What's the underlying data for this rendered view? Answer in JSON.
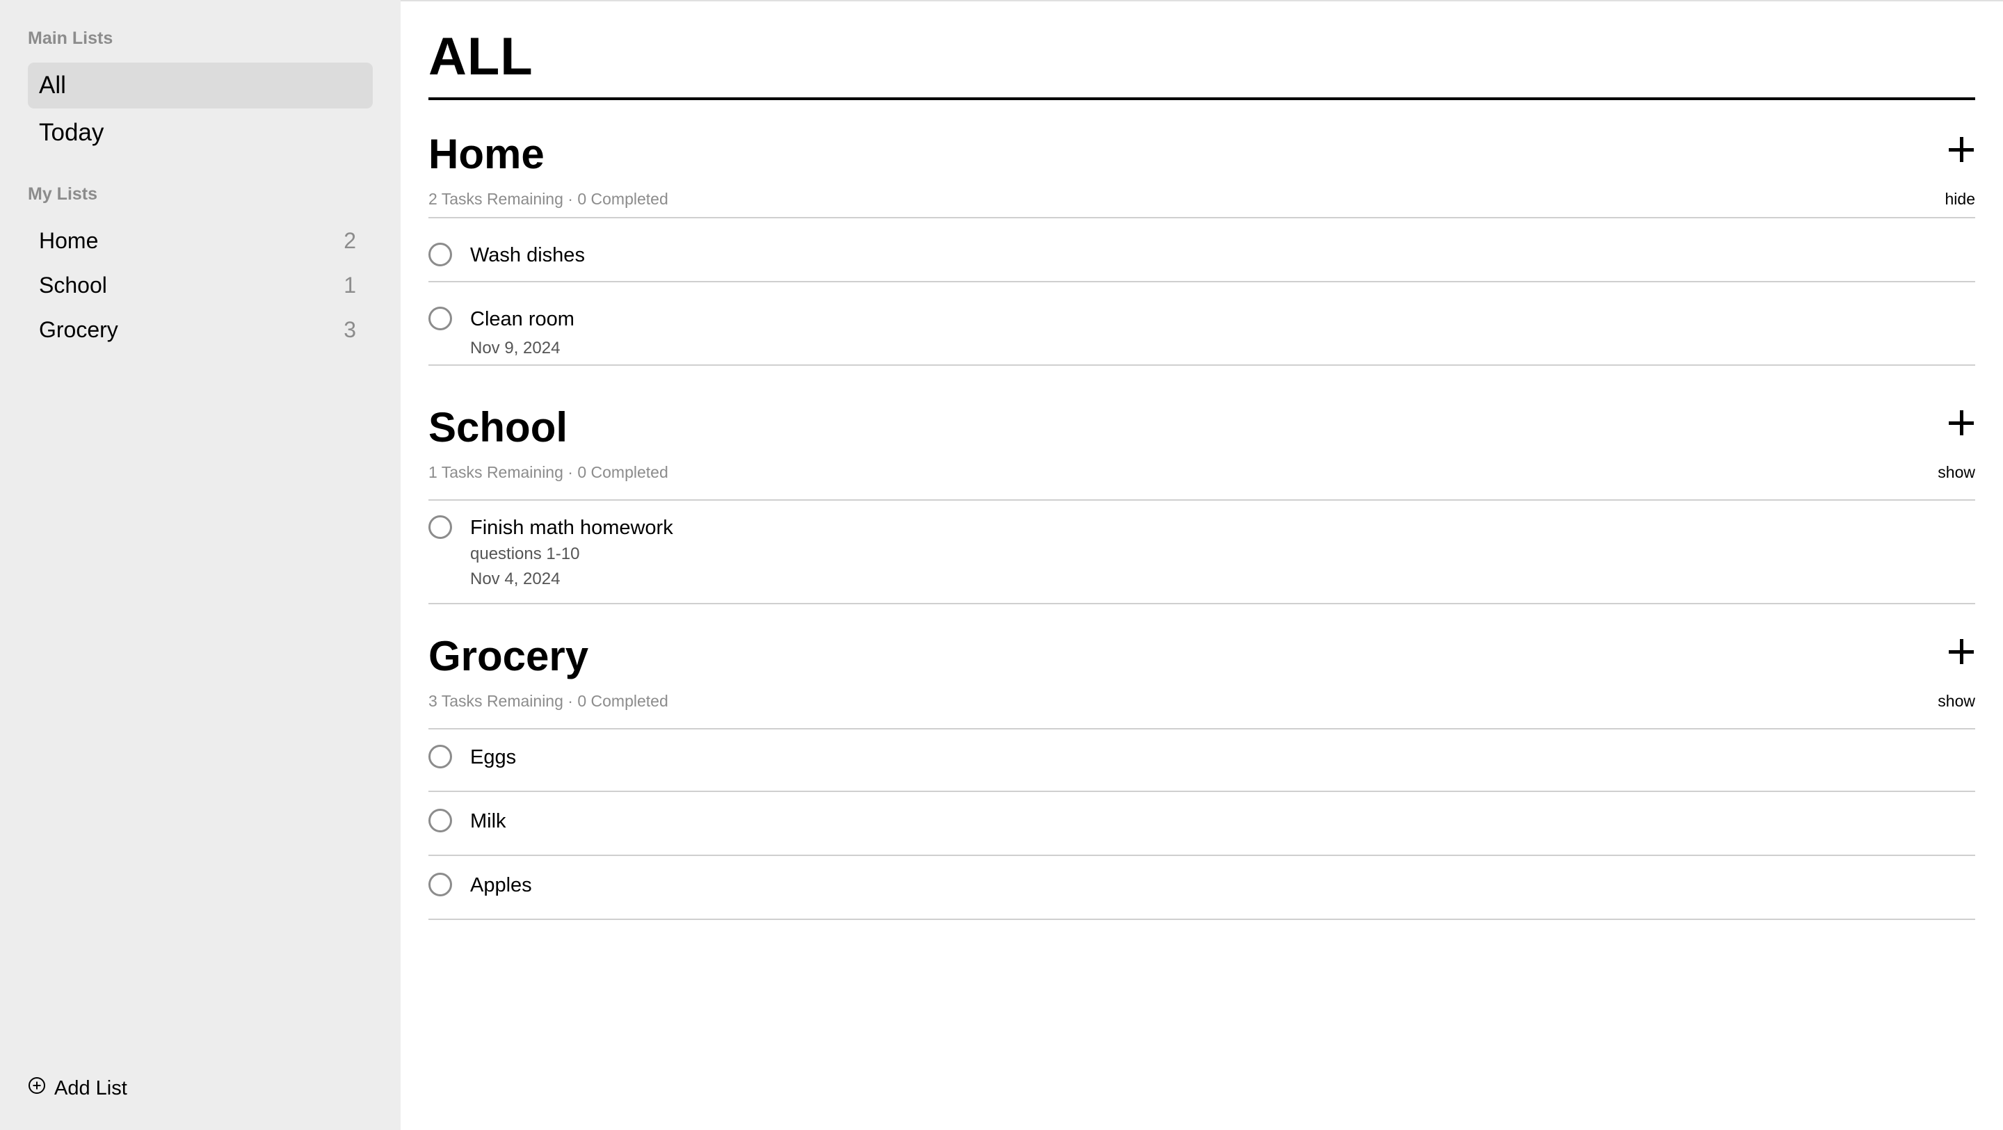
{
  "sidebar": {
    "main_heading": "Main Lists",
    "main_items": [
      {
        "label": "All"
      },
      {
        "label": "Today"
      }
    ],
    "my_heading": "My Lists",
    "my_items": [
      {
        "label": "Home",
        "count": "2"
      },
      {
        "label": "School",
        "count": "1"
      },
      {
        "label": "Grocery",
        "count": "3"
      }
    ],
    "add_list_label": "Add List"
  },
  "main": {
    "title": "ALL",
    "sections": [
      {
        "title": "Home",
        "meta": "2 Tasks Remaining · 0 Completed",
        "toggle": "hide",
        "tasks": [
          {
            "title": "Wash dishes"
          },
          {
            "title": "Clean room",
            "date": "Nov 9, 2024"
          }
        ]
      },
      {
        "title": "School",
        "meta": "1 Tasks Remaining · 0 Completed",
        "toggle": "show",
        "tasks": [
          {
            "title": "Finish math homework",
            "note": "questions 1-10",
            "date": "Nov 4, 2024"
          }
        ]
      },
      {
        "title": "Grocery",
        "meta": "3 Tasks Remaining · 0 Completed",
        "toggle": "show",
        "tasks": [
          {
            "title": "Eggs"
          },
          {
            "title": "Milk"
          },
          {
            "title": "Apples"
          }
        ]
      }
    ]
  },
  "colors": {
    "sidebar_bg": "#ededed",
    "selected_bg": "#dcdcdc",
    "muted_text": "#8c8c8c",
    "divider": "#cfcfcf"
  }
}
